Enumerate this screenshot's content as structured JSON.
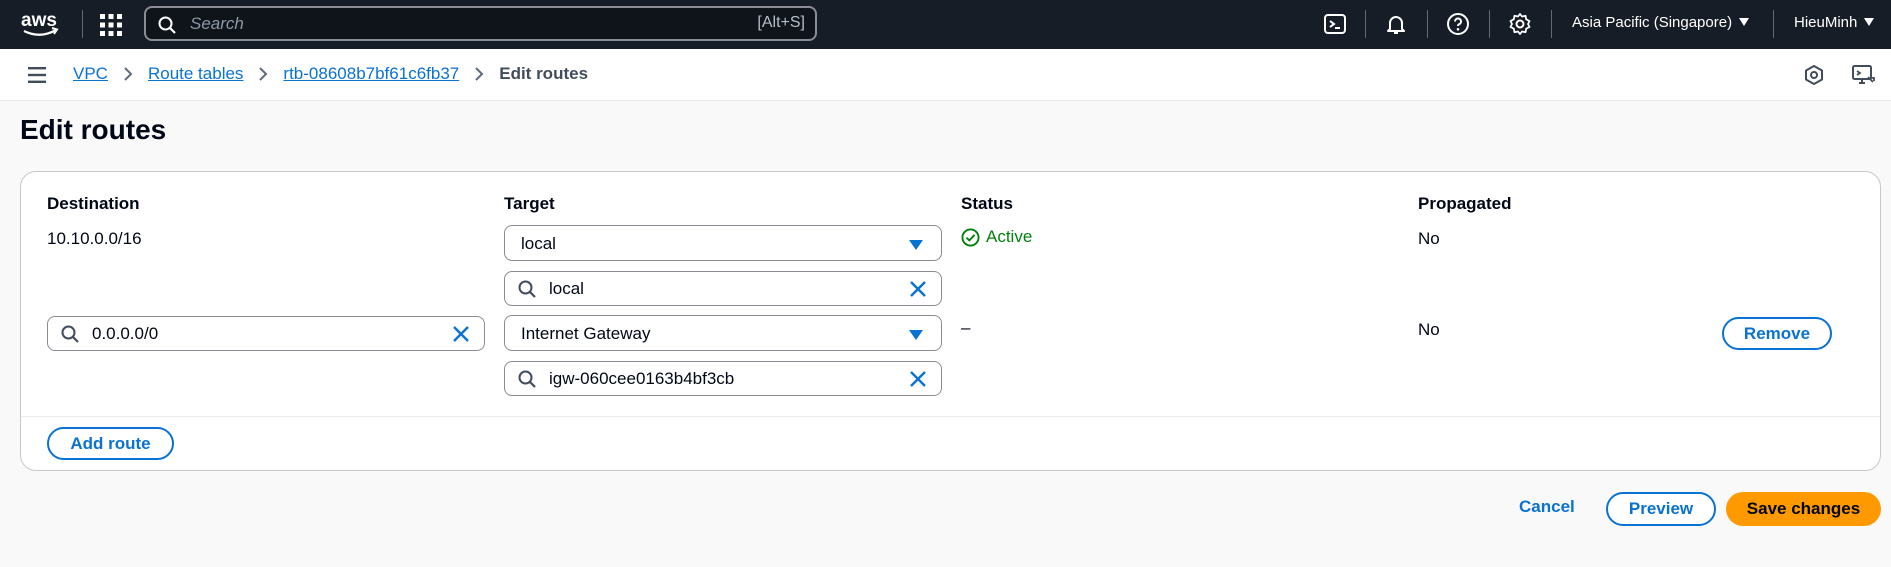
{
  "topnav": {
    "logo_text": "aws",
    "search_placeholder": "Search",
    "search_shortcut": "[Alt+S]",
    "region": "Asia Pacific (Singapore)",
    "user": "HieuMinh"
  },
  "breadcrumb": {
    "items": [
      "VPC",
      "Route tables",
      "rtb-08608b7bf61c6fb37"
    ],
    "current": "Edit routes"
  },
  "page": {
    "title": "Edit routes"
  },
  "routes_table": {
    "columns": {
      "destination": "Destination",
      "target": "Target",
      "status": "Status",
      "propagated": "Propagated"
    },
    "rows": [
      {
        "destination": "10.10.0.0/16",
        "target_type": "local",
        "target_value": "local",
        "status": "Active",
        "propagated": "No"
      },
      {
        "destination": "0.0.0.0/0",
        "target_type": "Internet Gateway",
        "target_value": "igw-060cee0163b4bf3cb",
        "status": "–",
        "propagated": "No",
        "remove_label": "Remove"
      }
    ],
    "add_route_label": "Add route"
  },
  "actions": {
    "cancel": "Cancel",
    "preview": "Preview",
    "save": "Save changes"
  },
  "colors": {
    "nav_bg": "#161d26",
    "link": "#0972d3",
    "success": "#037f0c",
    "primary": "#ff9900"
  }
}
